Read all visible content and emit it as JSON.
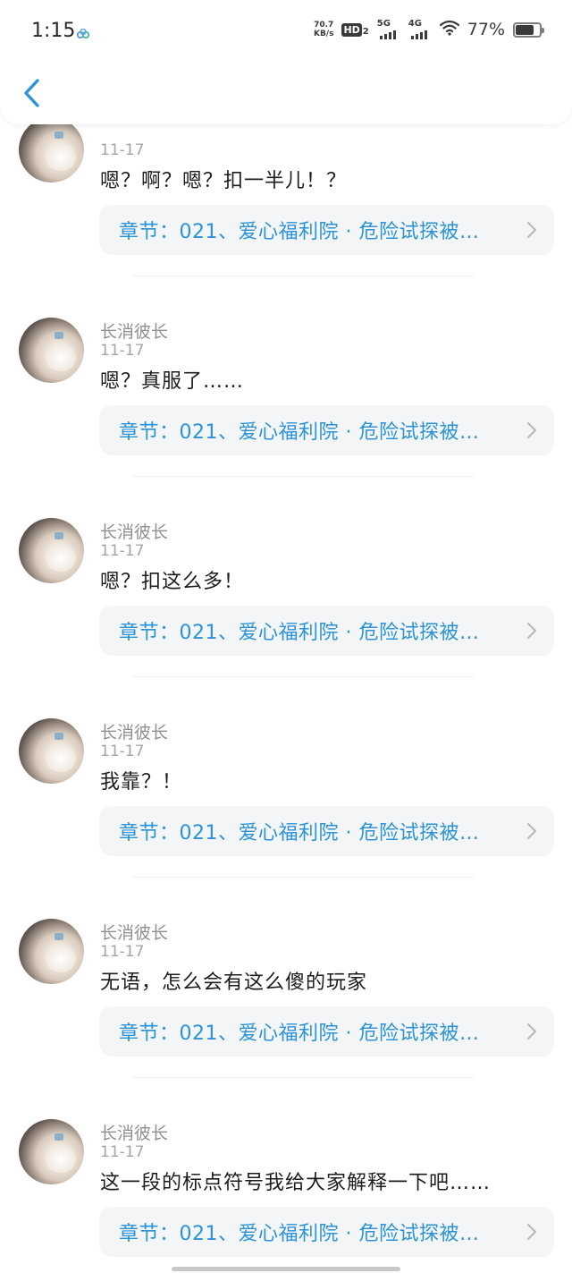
{
  "status_bar": {
    "time": "1:15",
    "net_speed_value": "70.7",
    "net_speed_unit": "KB/s",
    "hd_label": "HD",
    "hd_sub": "2",
    "signal_1_label": "5G",
    "signal_2_label": "4G",
    "battery_percent": "77%",
    "battery_level": 0.77
  },
  "header": {
    "back_icon": "chevron-left-icon"
  },
  "colors": {
    "accent": "#2b93d6",
    "chapter_bg": "#f4f5f7"
  },
  "comments": [
    {
      "username": "",
      "date": "11-17",
      "text": "嗯？啊？嗯？扣一半儿！？",
      "chapter": "章节：021、爱心福利院 · 危险试探被…"
    },
    {
      "username": "长消彼长",
      "date": "11-17",
      "text": "嗯？真服了……",
      "chapter": "章节：021、爱心福利院 · 危险试探被…"
    },
    {
      "username": "长消彼长",
      "date": "11-17",
      "text": "嗯？扣这么多！",
      "chapter": "章节：021、爱心福利院 · 危险试探被…"
    },
    {
      "username": "长消彼长",
      "date": "11-17",
      "text": "我靠？！",
      "chapter": "章节：021、爱心福利院 · 危险试探被…"
    },
    {
      "username": "长消彼长",
      "date": "11-17",
      "text": "无语，怎么会有这么傻的玩家",
      "chapter": "章节：021、爱心福利院 · 危险试探被…"
    },
    {
      "username": "长消彼长",
      "date": "11-17",
      "text": "这一段的标点符号我给大家解释一下吧……",
      "chapter": "章节：021、爱心福利院 · 危险试探被…"
    }
  ]
}
